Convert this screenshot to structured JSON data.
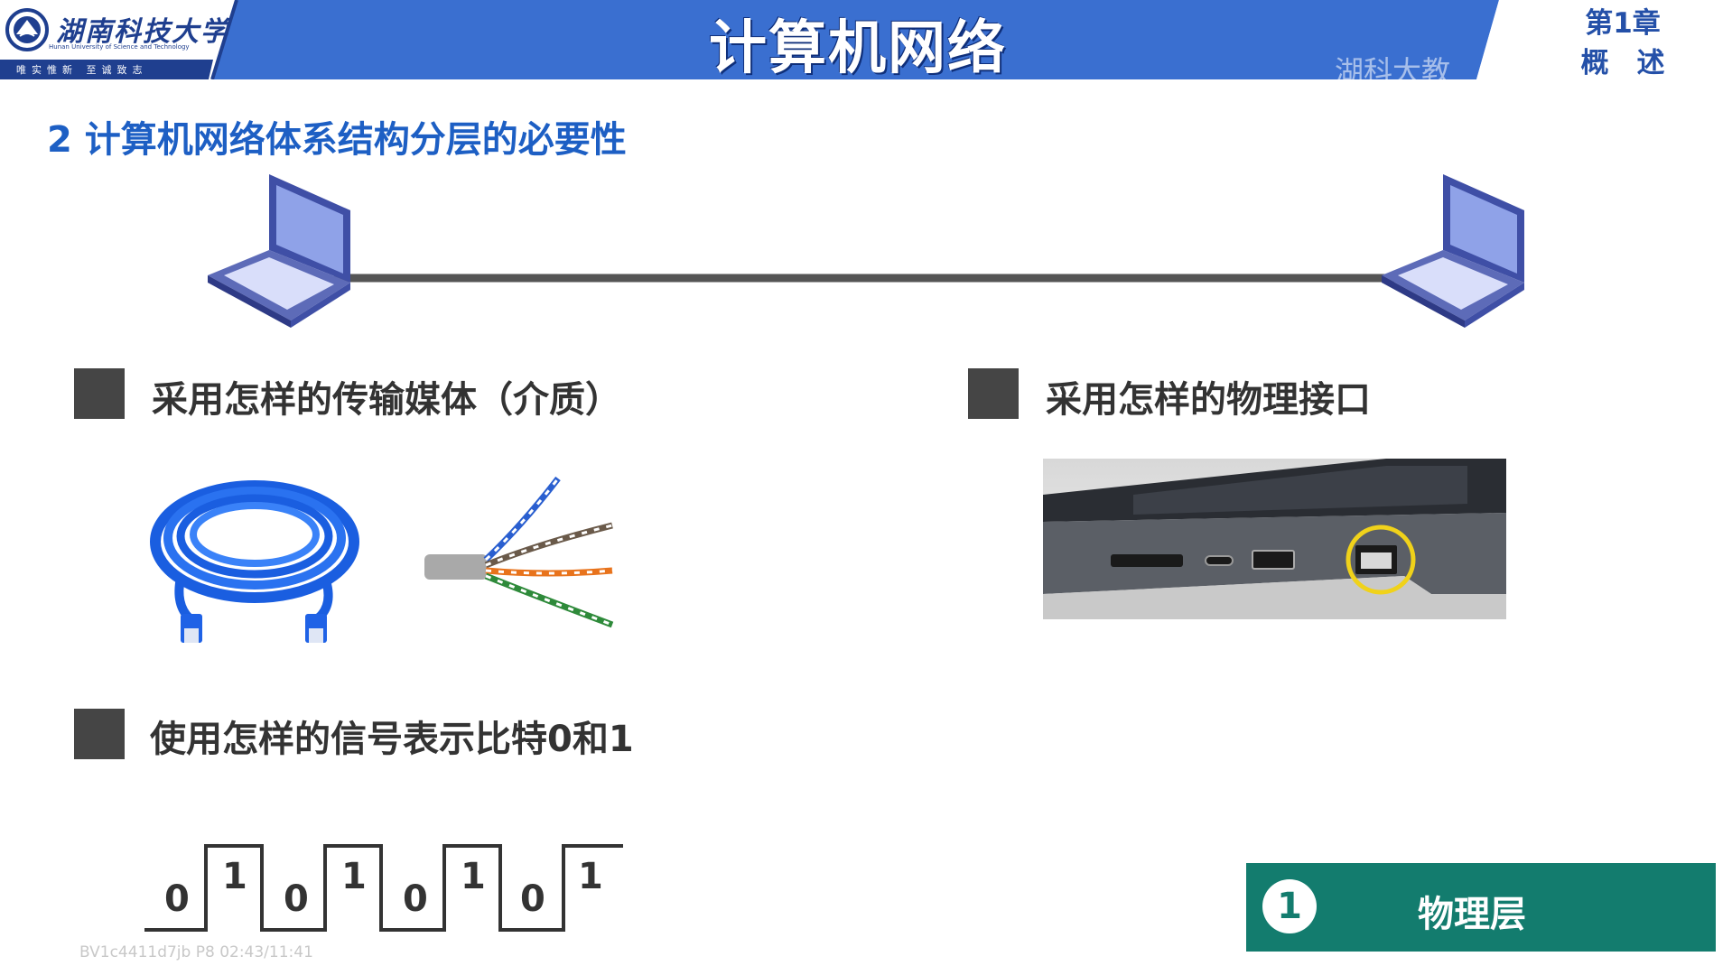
{
  "header": {
    "university_name": "湖南科技大学",
    "university_english": "Hunan University of Science and Technology",
    "university_motto": "唯实惟新  至诚致志",
    "course_title": "计算机网络",
    "watermark": "湖科大教",
    "chapter_label": "第1章",
    "chapter_name": "概　述",
    "colors": {
      "header_blue": "#3a6fd0",
      "header_dark": "#1f3f8f"
    }
  },
  "section": {
    "title": "2 计算机网络体系结构分层的必要性",
    "bullets": [
      {
        "text": "采用怎样的传输媒体（介质）"
      },
      {
        "text": "采用怎样的物理接口"
      },
      {
        "text": "使用怎样的信号表示比特0和1"
      }
    ]
  },
  "signal": {
    "bits": [
      "0",
      "1",
      "0",
      "1",
      "0",
      "1",
      "0",
      "1"
    ]
  },
  "layer_label": {
    "number": "1",
    "name": "物理层",
    "color": "#137c6e"
  },
  "video_id": "BV1c4411d7jb P8 02:43/11:41",
  "icons": [
    "laptop-icon",
    "ethernet-cable-icon",
    "twisted-pair-icon",
    "rj45-port-icon"
  ]
}
